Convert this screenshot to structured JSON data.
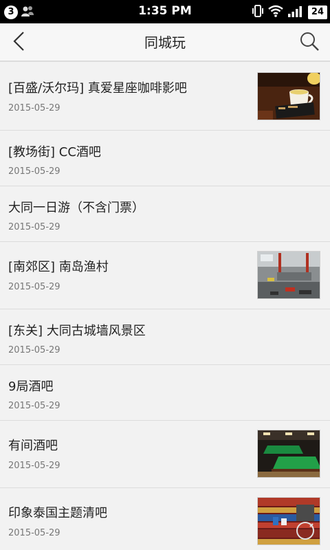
{
  "status_bar": {
    "notification_count": "3",
    "time": "1:35 PM",
    "battery": "24"
  },
  "header": {
    "title": "同城玩"
  },
  "items": [
    {
      "title": "[百盛/沃尔玛] 真爱星座咖啡影吧",
      "date": "2015-05-29",
      "has_image": true
    },
    {
      "title": "[教场街] CC酒吧",
      "date": "2015-05-29",
      "has_image": false
    },
    {
      "title": "大同一日游（不含门票）",
      "date": "2015-05-29",
      "has_image": false
    },
    {
      "title": "[南郊区] 南岛渔村",
      "date": "2015-05-29",
      "has_image": true
    },
    {
      "title": "[东关] 大同古城墙风景区",
      "date": "2015-05-29",
      "has_image": false
    },
    {
      "title": "9局酒吧",
      "date": "2015-05-29",
      "has_image": false
    },
    {
      "title": "有间酒吧",
      "date": "2015-05-29",
      "has_image": true
    },
    {
      "title": "印象泰国主题清吧",
      "date": "2015-05-29",
      "has_image": true
    }
  ]
}
